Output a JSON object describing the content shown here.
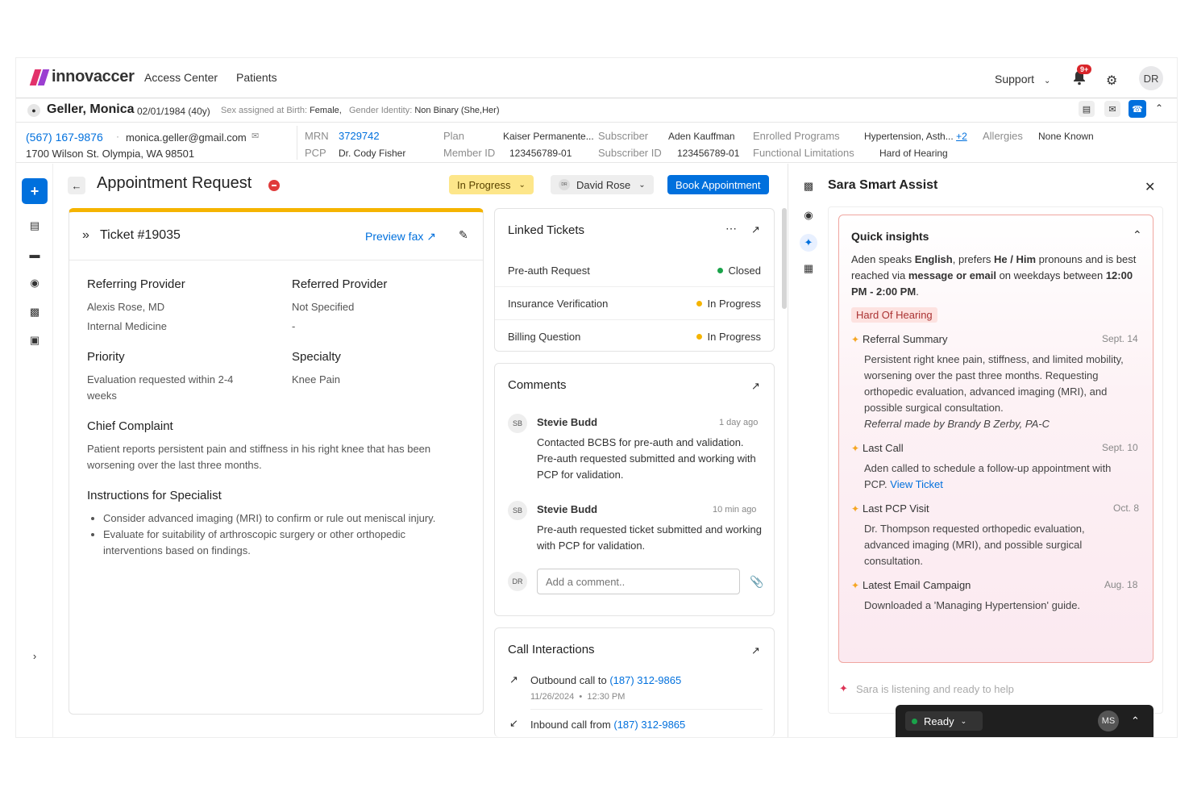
{
  "nav": {
    "brand": "innovaccer",
    "links": [
      "Access Center",
      "Patients"
    ],
    "support": "Support",
    "notif_count": "9+",
    "user_initials": "DR"
  },
  "patient": {
    "name": "Geller, Monica",
    "dob": "02/01/1984 (40y)",
    "sex_label": "Sex assigned at Birth:",
    "sex": "Female,",
    "gender_label": "Gender Identity:",
    "gender": "Non Binary (She,Her)",
    "phone": "(567) 167-9876",
    "email": "monica.geller@gmail.com",
    "address": "1700 Wilson St. Olympia, WA 98501",
    "mrn_label": "MRN",
    "mrn": "3729742",
    "pcp_label": "PCP",
    "pcp": "Dr. Cody Fisher",
    "plan_label": "Plan",
    "plan": "Kaiser Permanente...",
    "member_label": "Member ID",
    "member": "123456789-01",
    "subscriber_label": "Subscriber",
    "subscriber": "Aden Kauffman",
    "subid_label": "Subscriber ID",
    "subid": "123456789-01",
    "programs_label": "Enrolled Programs",
    "programs": "Hypertension, Asth...",
    "programs_more": "+2",
    "limit_label": "Functional Limitations",
    "limit": "Hard of Hearing",
    "allergies_label": "Allergies",
    "allergies": "None Known"
  },
  "header": {
    "title": "Appointment Request",
    "status": "In Progress",
    "assignee_initials": "DR",
    "assignee": "David Rose",
    "book": "Book Appointment"
  },
  "ticket": {
    "id": "Ticket #19035",
    "preview": "Preview fax",
    "ref_prov_label": "Referring Provider",
    "ref_prov": "Alexis Rose, MD",
    "ref_prov_sub": "Internal Medicine",
    "refd_prov_label": "Referred Provider",
    "refd_prov": "Not Specified",
    "refd_prov_sub": "-",
    "priority_label": "Priority",
    "priority": "Evaluation requested within 2-4 weeks",
    "specialty_label": "Specialty",
    "specialty": "Knee Pain",
    "complaint_label": "Chief Complaint",
    "complaint": "Patient reports persistent pain and stiffness in his right knee that has been worsening over the last three months.",
    "instr_label": "Instructions for Specialist",
    "instr": [
      "Consider advanced imaging (MRI) to confirm or rule out meniscal injury.",
      "Evaluate for suitability of arthroscopic surgery or other orthopedic interventions based on findings."
    ]
  },
  "linked": {
    "title": "Linked Tickets",
    "items": [
      {
        "name": "Pre-auth Request",
        "status": "Closed",
        "color": "#1aa34a"
      },
      {
        "name": "Insurance Verification",
        "status": "In Progress",
        "color": "#f5b400"
      },
      {
        "name": "Billing Question",
        "status": "In Progress",
        "color": "#f5b400"
      }
    ]
  },
  "comments": {
    "title": "Comments",
    "items": [
      {
        "initials": "SB",
        "author": "Stevie Budd",
        "time": "1 day ago",
        "text": "Contacted BCBS for pre-auth and validation. Pre-auth requested submitted and working with PCP for validation."
      },
      {
        "initials": "SB",
        "author": "Stevie Budd",
        "time": "10 min ago",
        "text": "Pre-auth requested ticket submitted and working with PCP for validation."
      }
    ],
    "my_initials": "DR",
    "placeholder": "Add a comment.."
  },
  "calls": {
    "title": "Call Interactions",
    "items": [
      {
        "dir": "Outbound call to",
        "num": "(187) 312-9865",
        "date": "11/26/2024",
        "time": "12:30 PM"
      },
      {
        "dir": "Inbound call from",
        "num": "(187) 312-9865"
      }
    ]
  },
  "sara": {
    "title": "Sara Smart Assist",
    "insights_title": "Quick insights",
    "intro": {
      "p1": "Aden speaks ",
      "lang": "English",
      "p2": ", prefers ",
      "pron": "He / Him",
      "p3": " pronouns and is best reached via ",
      "via": "message or email",
      "p4": " on weekdays between ",
      "time": "12:00 PM - 2:00 PM",
      "p5": "."
    },
    "tag": "Hard Of Hearing",
    "sections": [
      {
        "title": "Referral Summary",
        "date": "Sept. 14",
        "text": "Persistent right knee pain, stiffness, and limited mobility, worsening over the past three months. Requesting orthopedic evaluation, advanced imaging (MRI), and possible surgical consultation.",
        "note": "Referral made by Brandy B Zerby, PA-C"
      },
      {
        "title": "Last Call",
        "date": "Sept. 10",
        "text": "Aden called to schedule a follow-up appointment with PCP.",
        "link": "View Ticket"
      },
      {
        "title": "Last PCP Visit",
        "date": "Oct. 8",
        "text": "Dr. Thompson requested orthopedic evaluation, advanced imaging (MRI), and possible surgical consultation."
      },
      {
        "title": "Latest Email Campaign",
        "date": "Aug. 18",
        "text": "Downloaded a 'Managing Hypertension' guide."
      }
    ],
    "listening": "Sara is listening and ready to help"
  },
  "status_bar": {
    "ready": "Ready",
    "initials": "MS"
  }
}
